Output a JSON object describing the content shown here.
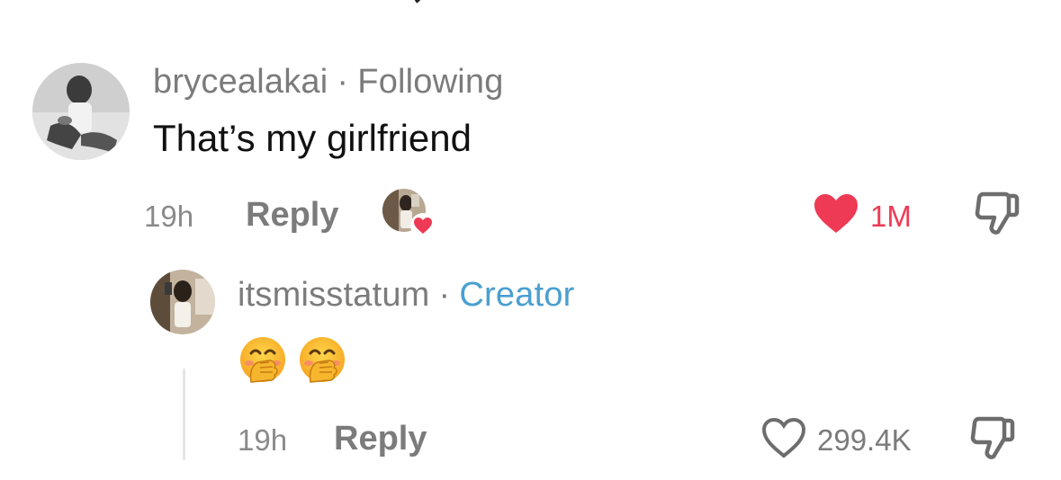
{
  "comment": {
    "username": "brycealakai",
    "separator": "·",
    "relation": "Following",
    "text": "That’s my girlfriend",
    "time": "19h",
    "reply_label": "Reply",
    "like_count": "1M",
    "liked": true,
    "creator_liked_badge": "heart-badge",
    "accent_color": "#ee3a55"
  },
  "reply": {
    "username": "itsmisstatum",
    "separator": "·",
    "badge": "Creator",
    "badge_color": "#4a9fd0",
    "emojis": [
      "hand-over-mouth-emoji",
      "hand-over-mouth-emoji"
    ],
    "time": "19h",
    "reply_label": "Reply",
    "like_count": "299.4K",
    "liked": false
  },
  "icons": {
    "like_filled": "heart-filled-icon",
    "like_outline": "heart-outline-icon",
    "dislike": "thumbs-down-icon"
  }
}
